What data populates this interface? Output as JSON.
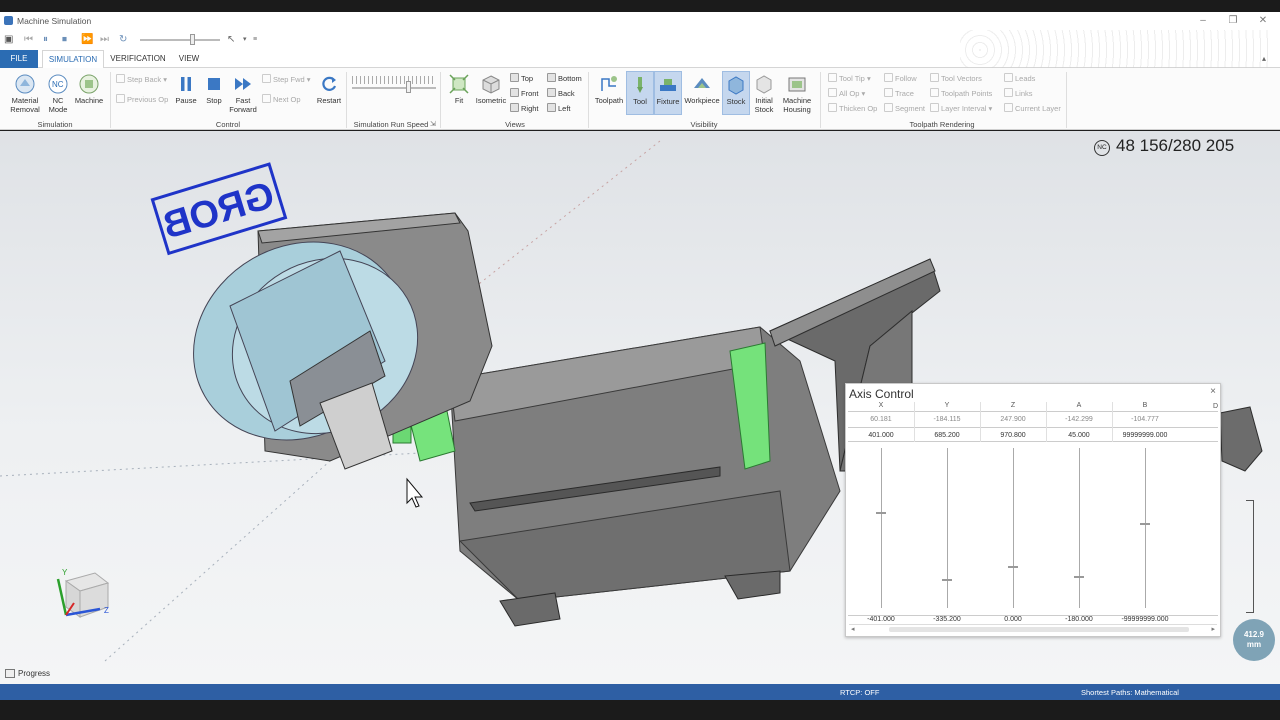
{
  "window": {
    "title": "Machine Simulation",
    "controls": [
      "–",
      "❐",
      "✕"
    ]
  },
  "tabs": [
    "FILE",
    "SIMULATION",
    "VERIFICATION",
    "VIEW"
  ],
  "ribbon": {
    "simulation_group": {
      "label": "Simulation",
      "material_removal": "Material Removal",
      "nc_mode": "NC Mode",
      "machine": "Machine"
    },
    "control_group": {
      "label": "Control",
      "step_back": "Step Back",
      "previous_op": "Previous Op",
      "pause": "Pause",
      "stop": "Stop",
      "fast_forward": "Fast Forward",
      "step_fwd": "Step Fwd",
      "next_op": "Next Op",
      "restart": "Restart"
    },
    "speed_group": {
      "label": "Simulation Run Speed"
    },
    "views_group": {
      "label": "Views",
      "fit": "Fit",
      "isometric": "Isometric",
      "top": "Top",
      "front": "Front",
      "right": "Right",
      "bottom": "Bottom",
      "back": "Back",
      "left": "Left"
    },
    "visibility_group": {
      "label": "Visibility",
      "toolpath": "Toolpath",
      "tool": "Tool",
      "fixture": "Fixture",
      "workpiece": "Workpiece",
      "stock": "Stock",
      "initial_stock": "Initial Stock",
      "machine_housing": "Machine Housing"
    },
    "toolpath_rendering_group": {
      "label": "Toolpath Rendering",
      "tool_tip": "Tool Tip",
      "all_op": "All Op",
      "thicken_op": "Thicken Op",
      "follow": "Follow",
      "trace": "Trace",
      "segment": "Segment",
      "tool_vectors": "Tool Vectors",
      "toolpath_points": "Toolpath Points",
      "layer_interval": "Layer Interval",
      "leads": "Leads",
      "links": "Links",
      "current_layer": "Current Layer"
    }
  },
  "viewport": {
    "nc_counter_icon": "NC",
    "nc_counter": "48 156/280 205",
    "logo_text": "GROB",
    "triad": {
      "y": "Y",
      "z": "Z"
    },
    "distance_badge": {
      "value": "412.9",
      "unit": "mm"
    }
  },
  "axis_control": {
    "title": "Axis Control",
    "close": "×",
    "extra_header": "D",
    "axes": [
      {
        "name": "X",
        "current": "60.181",
        "max": "401.000",
        "min": "-401.000",
        "position": 0.6
      },
      {
        "name": "Y",
        "current": "-184.115",
        "max": "685.200",
        "min": "-335.200",
        "position": 0.18
      },
      {
        "name": "Z",
        "current": "247.900",
        "max": "970.800",
        "min": "0.000",
        "position": 0.26
      },
      {
        "name": "A",
        "current": "-142.299",
        "max": "45.000",
        "min": "-180.000",
        "position": 0.2
      },
      {
        "name": "B",
        "current": "-104.777",
        "max": "99999999.000",
        "min": "-99999999.000",
        "position": 0.53
      }
    ]
  },
  "progress": {
    "label": "Progress"
  },
  "status": {
    "rtcp": "RTCP: OFF",
    "shortest_paths": "Shortest Paths: Mathematical"
  }
}
